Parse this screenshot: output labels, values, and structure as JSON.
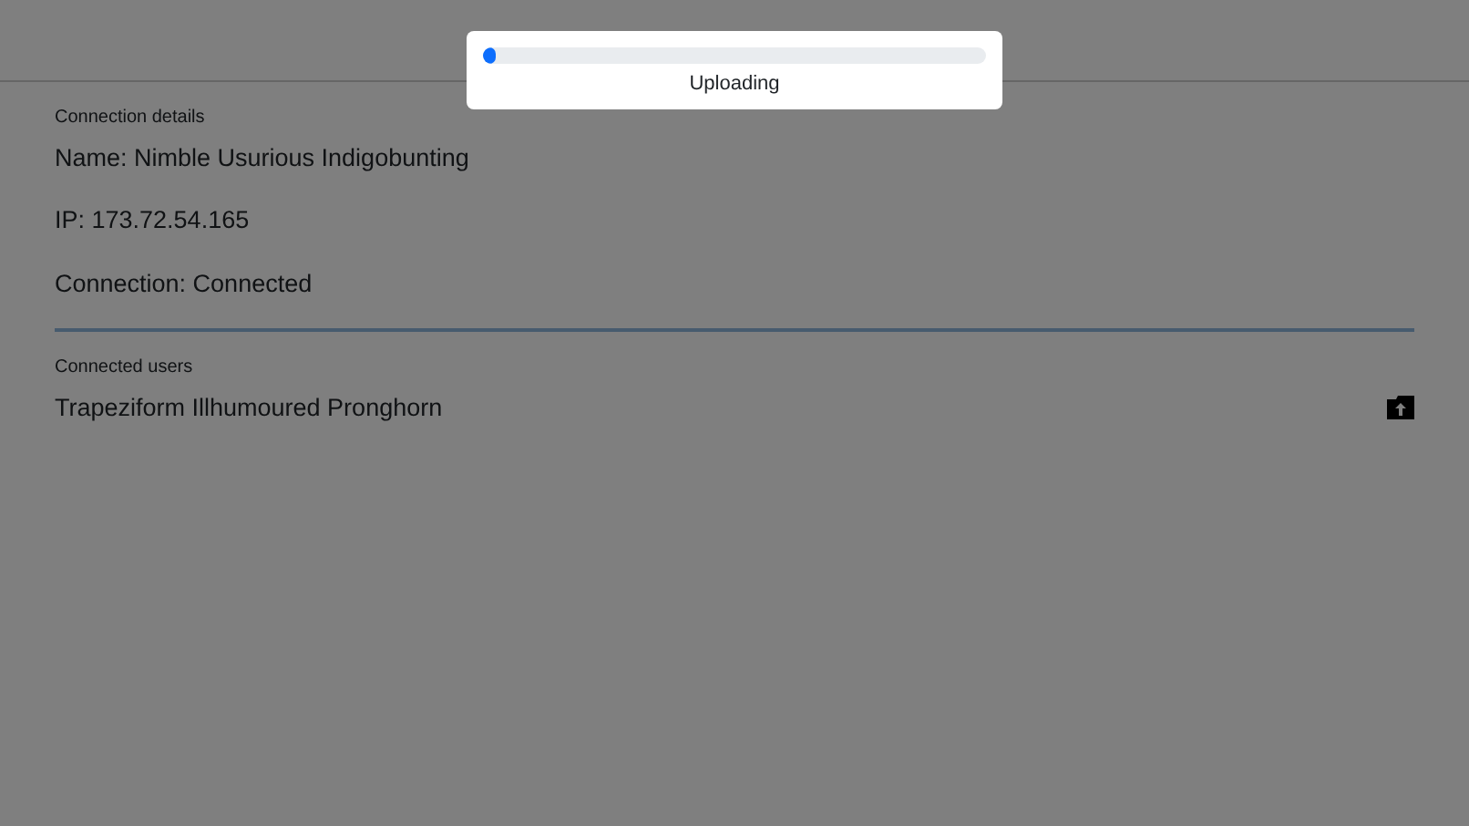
{
  "connection_details": {
    "heading": "Connection details",
    "lines": [
      "Name: Nimble Usurious Indigobunting",
      "IP: 173.72.54.165",
      "Connection: Connected"
    ]
  },
  "connected_users": {
    "heading": "Connected users",
    "users": [
      {
        "name": "Trapeziform Illhumoured Pronghorn"
      }
    ]
  },
  "modal": {
    "progress": {
      "level": 0.025
    },
    "label": "Uploading"
  }
}
